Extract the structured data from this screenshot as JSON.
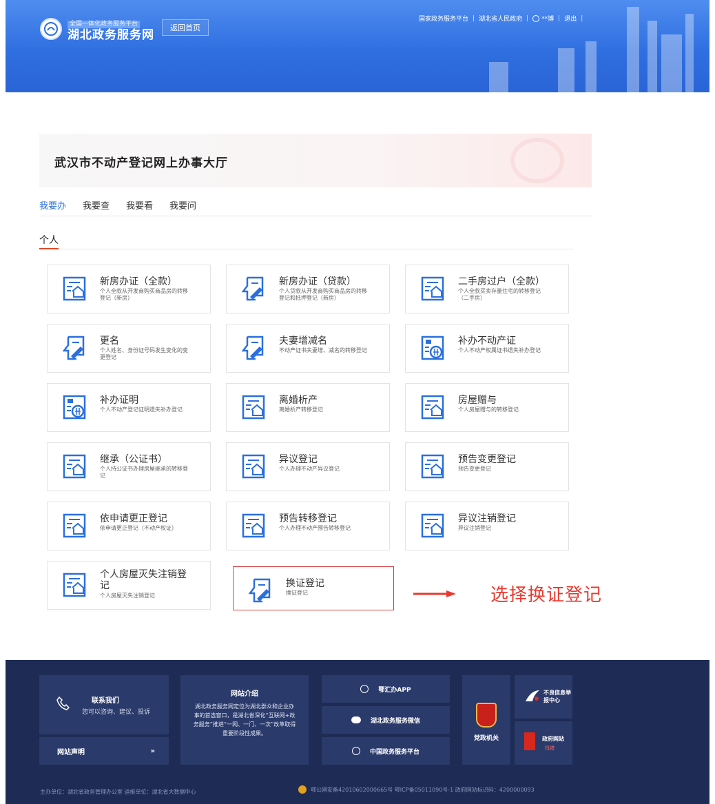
{
  "header": {
    "logo_sub": "全国一体化政务服务平台",
    "logo_main": "湖北政务服务网",
    "home_button": "返回首页",
    "links": [
      "国家政务服务平台",
      "湖北省人民政府"
    ],
    "user": "**博",
    "logout": "退出"
  },
  "banner": {
    "title": "武汉市不动产登记网上办事大厅"
  },
  "tabs": [
    {
      "label": "我要办",
      "active": true
    },
    {
      "label": "我要查",
      "active": false
    },
    {
      "label": "我要看",
      "active": false
    },
    {
      "label": "我要问",
      "active": false
    }
  ],
  "section": {
    "label": "个人"
  },
  "cards": [
    {
      "title": "新房办证（全款）",
      "desc": "个人全款从开发商购买商品房的转移登记（新房）",
      "icon": "house-doc-icon"
    },
    {
      "title": "新房办证（贷款）",
      "desc": "个人贷款从开发商购买商品房的转移登记和抵押登记（新房）",
      "icon": "doc-sign-icon"
    },
    {
      "title": "二手房过户（全款）",
      "desc": "个人全款买卖存量住宅的转移登记（二手房）",
      "icon": "house-doc-icon"
    },
    {
      "title": "更名",
      "desc": "个人姓名、身份证号码发生变化的变更登记",
      "icon": "doc-sign-icon"
    },
    {
      "title": "夫妻增减名",
      "desc": "不动产证书夫妻增、减名的转移登记",
      "icon": "doc-sign-icon"
    },
    {
      "title": "补办不动产证",
      "desc": "个人不动产权属证书遗失补办登记",
      "icon": "doc-reissue-icon"
    },
    {
      "title": "补办证明",
      "desc": "个人不动产登记证明遗失补办登记",
      "icon": "doc-reissue-icon"
    },
    {
      "title": "离婚析产",
      "desc": "离婚析产转移登记",
      "icon": "house-doc-icon"
    },
    {
      "title": "房屋赠与",
      "desc": "个人房屋赠与的转移登记",
      "icon": "house-doc-icon"
    },
    {
      "title": "继承（公证书）",
      "desc": "个人持公证书办理房屋继承的转移登记",
      "icon": "house-doc-icon"
    },
    {
      "title": "异议登记",
      "desc": "个人办理不动产异议登记",
      "icon": "house-doc-icon"
    },
    {
      "title": "预告变更登记",
      "desc": "预告变更登记",
      "icon": "house-doc-icon"
    },
    {
      "title": "依申请更正登记",
      "desc": "依申请更正登记（不动产权证）",
      "icon": "house-doc-icon"
    },
    {
      "title": "预告转移登记",
      "desc": "个人办理不动产预告转移登记",
      "icon": "house-doc-icon"
    },
    {
      "title": "异议注销登记",
      "desc": "异议注销登记",
      "icon": "house-doc-icon"
    },
    {
      "title": "个人房屋灭失注销登记",
      "desc": "个人房屋灭失注销登记",
      "icon": "house-doc-icon"
    },
    {
      "title": "换证登记",
      "desc": "换证登记",
      "icon": "doc-sign-icon",
      "selected": true
    }
  ],
  "annotation": {
    "text": "选择换证登记",
    "color": "#e83a2f"
  },
  "footer": {
    "contact_title": "联系我们",
    "contact_desc": "您可以咨询、建议、投诉",
    "declaration": "网站声明",
    "intro_title": "网站介绍",
    "intro_text": "湖北政务服务网定位为湖北群众和企业办事的首选窗口，是湖北省深化“互联网+政务服务”推进“一网、一门、一次”改革取得重要阶段性成果。",
    "apps": [
      "鄂汇办APP",
      "湖北政务服务微信",
      "中国政务服务平台"
    ],
    "party": "党政机关",
    "xinxin": "不良信息举报中心",
    "gov_site": "政府网站",
    "gov_site_sub": "找错",
    "sponsor": "主办单位：湖北省政务管理办公室  运维单位：湖北省大数据中心",
    "icp": "鄂公网安备42010602000665号  鄂ICP备05011090号-1  政府网站标识码：4200000093"
  },
  "colors": {
    "primary": "#2a6fe0",
    "accent": "#e04a2a",
    "footer_bg": "#1d2b55"
  }
}
